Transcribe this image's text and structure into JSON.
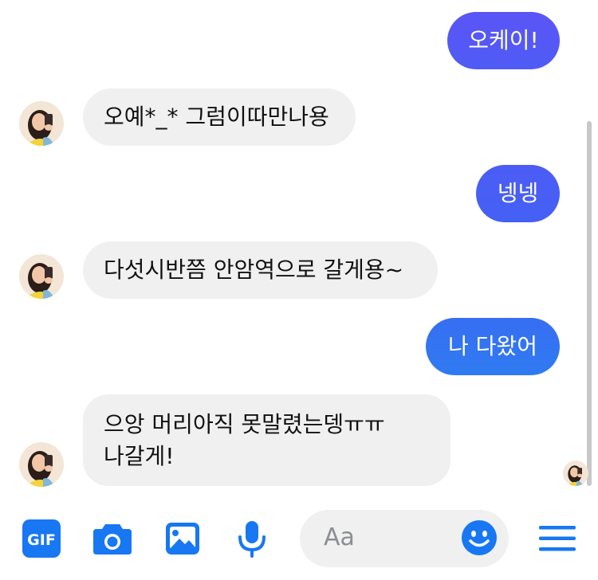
{
  "colors": {
    "outgoing_gradient_top": "#5b55f6",
    "outgoing_gradient_mid": "#4c5cf5",
    "outgoing_gradient_bottom": "#2f7bf1",
    "incoming_bubble": "#f0f0f0",
    "accent_icons": "#1877f2"
  },
  "messages": [
    {
      "direction": "outgoing",
      "text": "오케이!"
    },
    {
      "direction": "incoming",
      "text": "오예*_* 그럼이따만나용"
    },
    {
      "direction": "outgoing",
      "text": "넹넹"
    },
    {
      "direction": "incoming",
      "text": "다섯시반쯤 안암역으로 갈게용~"
    },
    {
      "direction": "outgoing",
      "text": "나 다왔어"
    },
    {
      "direction": "incoming",
      "lines": [
        "으앙 머리아직 못말렸는뎅ㅠㅠ",
        "나갈게!"
      ]
    }
  ],
  "composer": {
    "gif_label": "GIF",
    "gif_icon": "gif-icon",
    "camera_icon": "camera-icon",
    "image_icon": "image-icon",
    "mic_icon": "microphone-icon",
    "placeholder": "Aa",
    "emoji_icon": "smiley-icon",
    "menu_icon": "menu-icon"
  }
}
